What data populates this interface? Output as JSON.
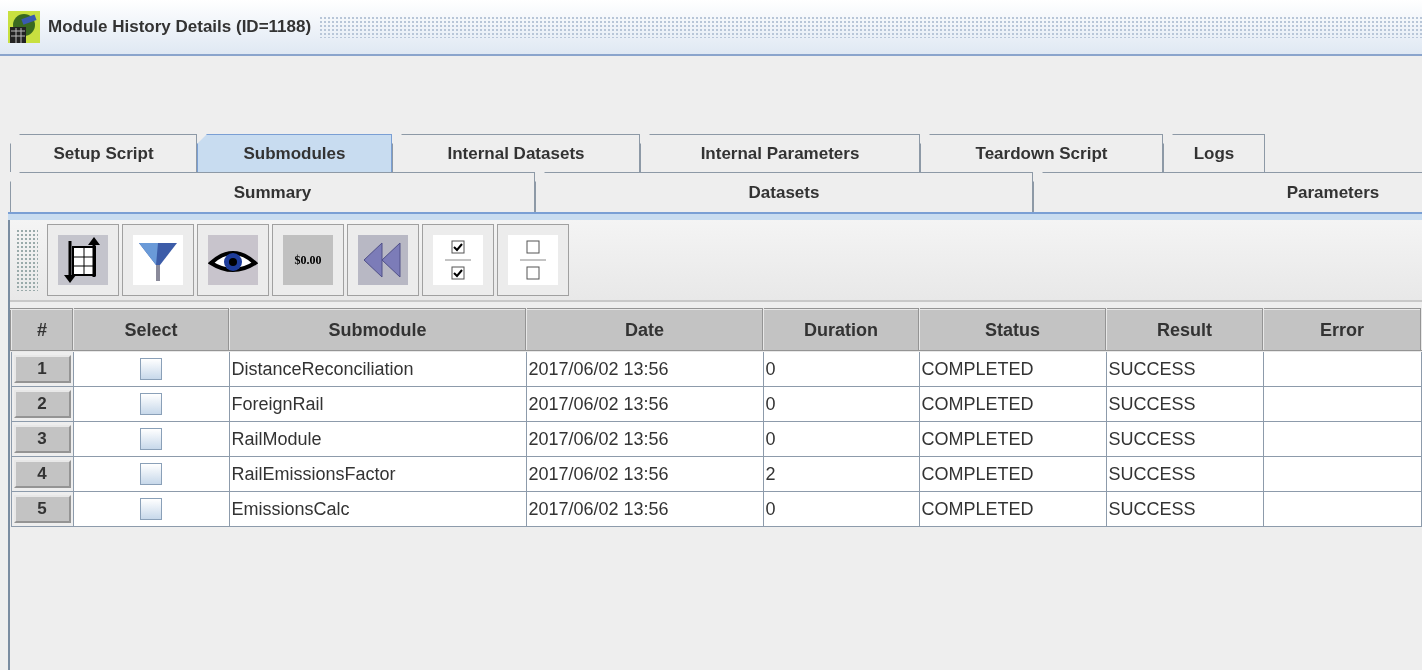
{
  "window": {
    "title": "Module History Details (ID=1188)"
  },
  "tabs_row_1": [
    {
      "label": "Setup Script",
      "selected": false
    },
    {
      "label": "Submodules",
      "selected": true
    },
    {
      "label": "Internal Datasets",
      "selected": false
    },
    {
      "label": "Internal Parameters",
      "selected": false
    },
    {
      "label": "Teardown Script",
      "selected": false
    },
    {
      "label": "Logs",
      "selected": false
    }
  ],
  "tabs_row_2": [
    {
      "label": "Summary",
      "selected": false
    },
    {
      "label": "Datasets",
      "selected": false
    },
    {
      "label": "Parameters",
      "selected": false
    }
  ],
  "toolbar": [
    {
      "kind": "sort"
    },
    {
      "kind": "filter"
    },
    {
      "kind": "view"
    },
    {
      "kind": "format",
      "label": "$0.00"
    },
    {
      "kind": "reset"
    },
    {
      "kind": "select-all"
    },
    {
      "kind": "clear-all"
    }
  ],
  "table": {
    "columns": [
      "#",
      "Select",
      "Submodule",
      "Date",
      "Duration",
      "Status",
      "Result",
      "Error"
    ],
    "rows": [
      {
        "index": "1",
        "selected": false,
        "submodule": "DistanceReconciliation",
        "date": "2017/06/02 13:56",
        "duration": "0",
        "status": "COMPLETED",
        "result": "SUCCESS"
      },
      {
        "index": "2",
        "selected": false,
        "submodule": "ForeignRail",
        "date": "2017/06/02 13:56",
        "duration": "0",
        "status": "COMPLETED",
        "result": "SUCCESS"
      },
      {
        "index": "3",
        "selected": false,
        "submodule": "RailModule",
        "date": "2017/06/02 13:56",
        "duration": "0",
        "status": "COMPLETED",
        "result": "SUCCESS"
      },
      {
        "index": "4",
        "selected": false,
        "submodule": "RailEmissionsFactor",
        "date": "2017/06/02 13:56",
        "duration": "2",
        "status": "COMPLETED",
        "result": "SUCCESS"
      },
      {
        "index": "5",
        "selected": false,
        "submodule": "EmissionsCalc",
        "date": "2017/06/02 13:56",
        "duration": "0",
        "status": "COMPLETED",
        "result": "SUCCESS"
      }
    ]
  }
}
